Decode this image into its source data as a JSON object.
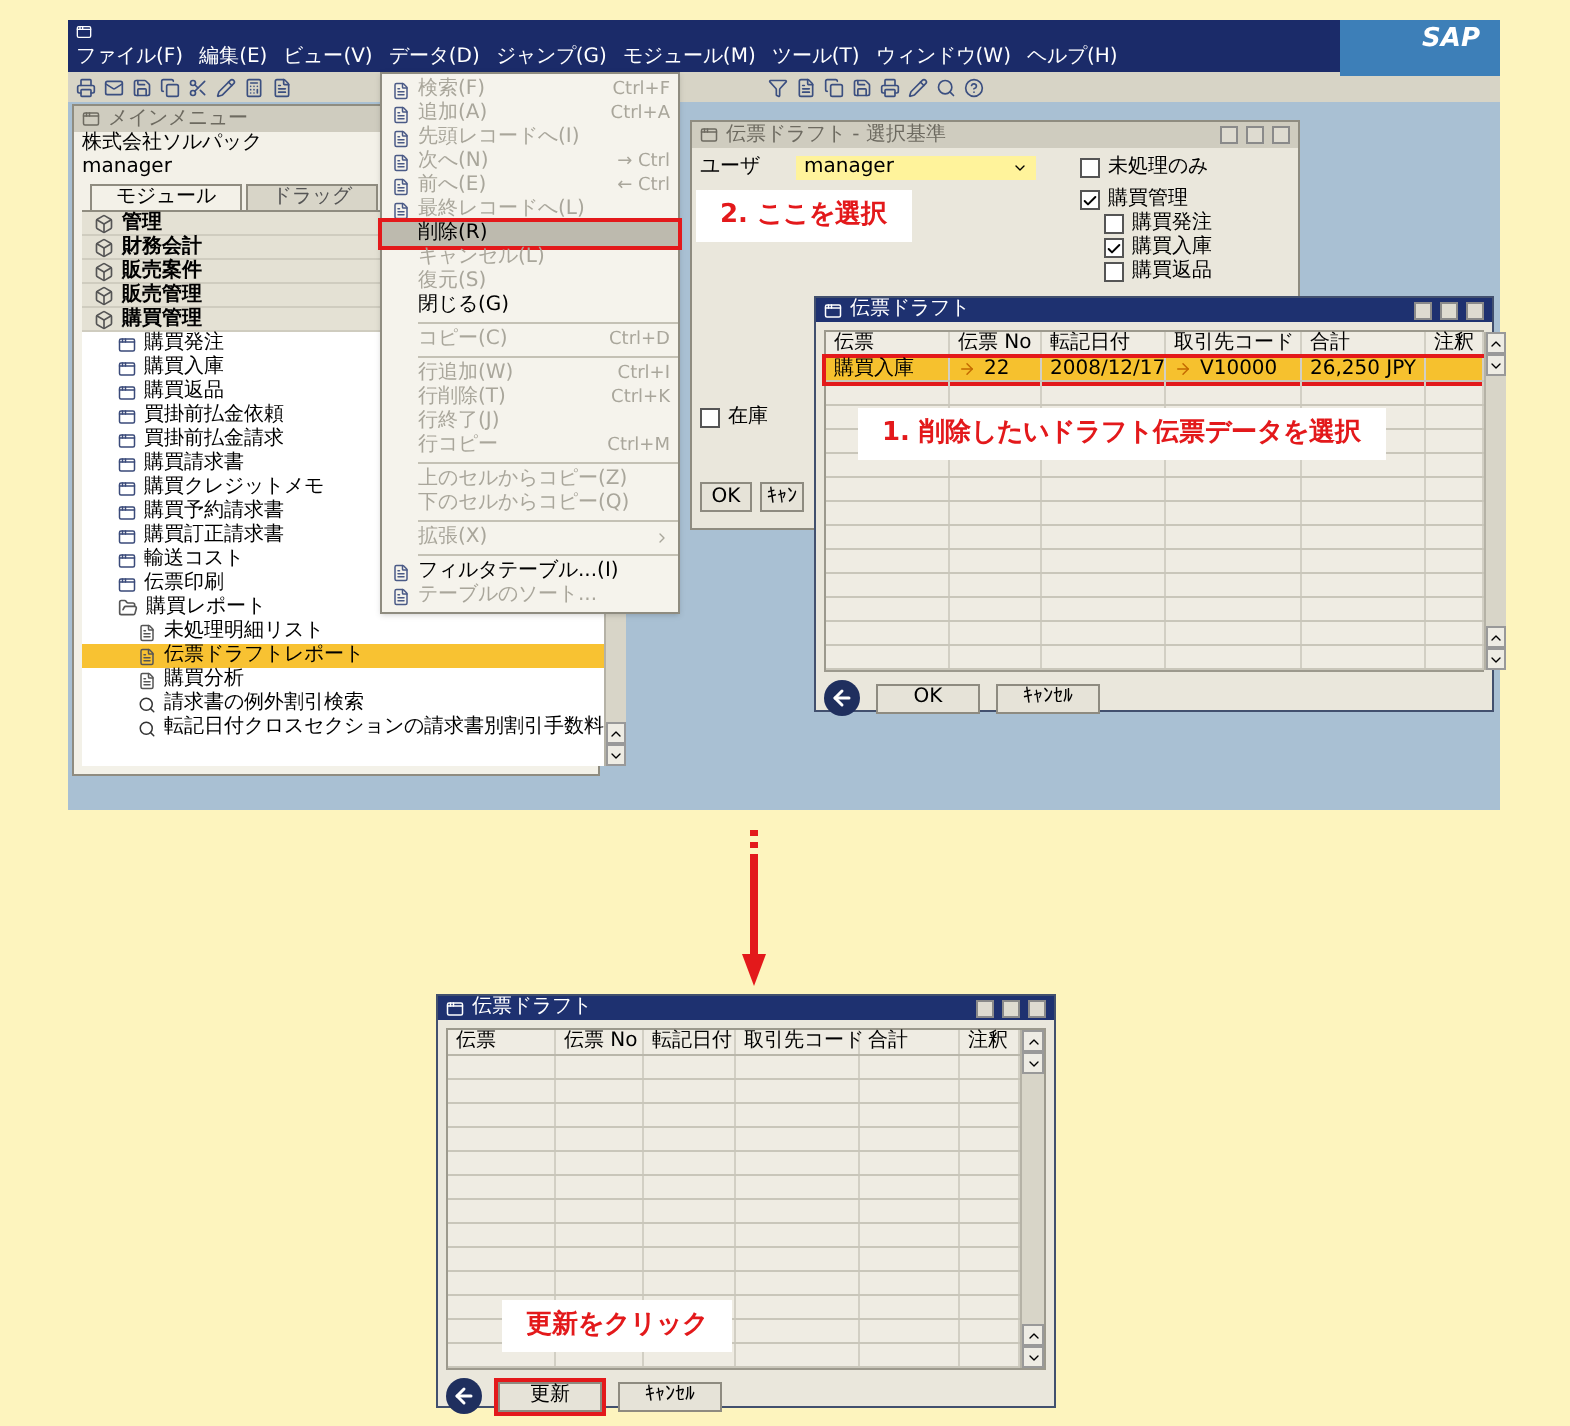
{
  "app_window": {
    "menu_bar": [
      "ファイル(F)",
      "編集(E)",
      "ビュー(V)",
      "データ(D)",
      "ジャンプ(G)",
      "モジュール(M)",
      "ツール(T)",
      "ウィンドウ(W)",
      "ヘルプ(H)"
    ],
    "logo": "SAP"
  },
  "main_menu": {
    "title": "メインメニュー",
    "company": "株式会社ソルパック",
    "user": "manager",
    "tabs": [
      {
        "label": "モジュール",
        "selected": true
      },
      {
        "label": "ドラッグ",
        "selected": false
      }
    ],
    "items": [
      {
        "label": "管理",
        "kind": "module",
        "selected": false
      },
      {
        "label": "財務会計",
        "kind": "module",
        "selected": false
      },
      {
        "label": "販売案件",
        "kind": "module",
        "selected": false
      },
      {
        "label": "販売管理",
        "kind": "module",
        "selected": false
      },
      {
        "label": "購買管理",
        "kind": "module",
        "selected": false,
        "expanded": true,
        "children": [
          {
            "label": "購買発注",
            "kind": "form",
            "selected": false
          },
          {
            "label": "購買入庫",
            "kind": "form",
            "selected": false
          },
          {
            "label": "購買返品",
            "kind": "form",
            "selected": false
          },
          {
            "label": "買掛前払金依頼",
            "kind": "form",
            "selected": false
          },
          {
            "label": "買掛前払金請求",
            "kind": "form",
            "selected": false
          },
          {
            "label": "購買請求書",
            "kind": "form",
            "selected": false
          },
          {
            "label": "購買クレジットメモ",
            "kind": "form",
            "selected": false
          },
          {
            "label": "購買予約請求書",
            "kind": "form",
            "selected": false
          },
          {
            "label": "購買訂正請求書",
            "kind": "form",
            "selected": false
          },
          {
            "label": "輸送コスト",
            "kind": "form",
            "selected": false
          },
          {
            "label": "伝票印刷",
            "kind": "form",
            "selected": false
          },
          {
            "label": "購買レポート",
            "kind": "folder",
            "selected": false,
            "expanded": true,
            "children": [
              {
                "label": "未処理明細リスト",
                "kind": "report",
                "selected": false
              },
              {
                "label": "伝票ドラフトレポート",
                "kind": "report",
                "selected": true
              },
              {
                "label": "購買分析",
                "kind": "report",
                "selected": false
              },
              {
                "label": "請求書の例外割引検索",
                "kind": "query",
                "selected": false
              },
              {
                "label": "転記日付クロスセクションの請求書別割引手数料",
                "kind": "query",
                "selected": false
              }
            ]
          }
        ]
      }
    ]
  },
  "data_menu": {
    "callout": "2. ここを選択",
    "items": [
      {
        "kind": "item",
        "label": "検索(F)",
        "shortcut": "Ctrl+F",
        "has_icon": true,
        "disabled": true,
        "selected": false,
        "highlighted": false
      },
      {
        "kind": "item",
        "label": "追加(A)",
        "shortcut": "Ctrl+A",
        "has_icon": true,
        "disabled": true,
        "selected": false,
        "highlighted": false
      },
      {
        "kind": "item",
        "label": "先頭レコードへ(I)",
        "has_icon": true,
        "disabled": true,
        "selected": false,
        "highlighted": false
      },
      {
        "kind": "item",
        "label": "次へ(N)",
        "shortcut": "→ Ctrl",
        "has_icon": true,
        "disabled": true,
        "selected": false,
        "highlighted": false
      },
      {
        "kind": "item",
        "label": "前へ(E)",
        "shortcut": "← Ctrl",
        "has_icon": true,
        "disabled": true,
        "selected": false,
        "highlighted": false
      },
      {
        "kind": "item",
        "label": "最終レコードへ(L)",
        "has_icon": true,
        "disabled": true,
        "selected": false,
        "highlighted": false
      },
      {
        "kind": "item",
        "label": "削除(R)",
        "has_icon": false,
        "disabled": false,
        "selected": true,
        "highlighted": true
      },
      {
        "kind": "item",
        "label": "キャンセル(L)",
        "has_icon": false,
        "disabled": true,
        "selected": false,
        "highlighted": false
      },
      {
        "kind": "item",
        "label": "復元(S)",
        "has_icon": false,
        "disabled": true,
        "selected": false,
        "highlighted": false
      },
      {
        "kind": "item",
        "label": "閉じる(G)",
        "has_icon": false,
        "disabled": false,
        "selected": false,
        "highlighted": false
      },
      {
        "kind": "separator"
      },
      {
        "kind": "item",
        "label": "コピー(C)",
        "shortcut": "Ctrl+D",
        "has_icon": false,
        "disabled": true,
        "selected": false,
        "highlighted": false
      },
      {
        "kind": "separator"
      },
      {
        "kind": "item",
        "label": "行追加(W)",
        "shortcut": "Ctrl+I",
        "has_icon": false,
        "disabled": true,
        "selected": false,
        "highlighted": false
      },
      {
        "kind": "item",
        "label": "行削除(T)",
        "shortcut": "Ctrl+K",
        "has_icon": false,
        "disabled": true,
        "selected": false,
        "highlighted": false
      },
      {
        "kind": "item",
        "label": "行終了(J)",
        "has_icon": false,
        "disabled": true,
        "selected": false,
        "highlighted": false
      },
      {
        "kind": "item",
        "label": "行コピー",
        "shortcut": "Ctrl+M",
        "has_icon": false,
        "disabled": true,
        "selected": false,
        "highlighted": false
      },
      {
        "kind": "separator"
      },
      {
        "kind": "item",
        "label": "上のセルからコピー(Z)",
        "has_icon": false,
        "disabled": true,
        "selected": false,
        "highlighted": false
      },
      {
        "kind": "item",
        "label": "下のセルからコピー(Q)",
        "has_icon": false,
        "disabled": true,
        "selected": false,
        "highlighted": false
      },
      {
        "kind": "separator"
      },
      {
        "kind": "item",
        "label": "拡張(X)",
        "has_icon": false,
        "disabled": true,
        "selected": false,
        "highlighted": false,
        "submenu": true
      },
      {
        "kind": "separator"
      },
      {
        "kind": "item",
        "label": "フィルタテーブル...(I)",
        "has_icon": true,
        "disabled": false,
        "selected": false,
        "highlighted": false
      },
      {
        "kind": "item",
        "label": "テーブルのソート...",
        "has_icon": true,
        "disabled": true,
        "selected": false,
        "highlighted": false
      }
    ]
  },
  "criteria_window": {
    "title": "伝票ドラフト - 選択基準",
    "user_label": "ユーザ",
    "user_value": "manager",
    "unprocessed": {
      "label": "未処理のみ",
      "checked": false
    },
    "module": {
      "label": "購買管理",
      "checked": true,
      "children": [
        {
          "label": "購買発注",
          "checked": false
        },
        {
          "label": "購買入庫",
          "checked": true
        },
        {
          "label": "購買返品",
          "checked": false
        }
      ]
    },
    "stock": {
      "label": "在庫",
      "checked": false
    },
    "buttons": [
      "OK",
      "ｷｬﾝ"
    ]
  },
  "drafts_window": {
    "title": "伝票ドラフト",
    "callout": "1. 削除したいドラフト伝票データを選択",
    "columns": [
      "伝票",
      "伝票 No",
      "転記日付",
      "取引先コード",
      "合計",
      "注釈"
    ],
    "rows": [
      {
        "selected": true,
        "highlighted": true,
        "cells": [
          {
            "text": "購買入庫",
            "link": false
          },
          {
            "text": "22",
            "link": true
          },
          {
            "text": "2008/12/17",
            "link": false
          },
          {
            "text": "V10000",
            "link": true
          },
          {
            "text": "26,250 JPY",
            "link": false
          }
        ]
      }
    ],
    "buttons": [
      {
        "label": "OK",
        "highlighted": false
      },
      {
        "label": "ｷｬﾝｾﾙ",
        "highlighted": false
      }
    ]
  },
  "result_window": {
    "title": "伝票ドラフト",
    "callout": "更新をクリック",
    "columns": [
      "伝票",
      "伝票 No",
      "転記日付",
      "取引先コード",
      "合計",
      "注釈"
    ],
    "buttons": [
      {
        "label": "更新",
        "highlighted": true
      },
      {
        "label": "ｷｬﾝｾﾙ",
        "highlighted": false
      }
    ]
  }
}
